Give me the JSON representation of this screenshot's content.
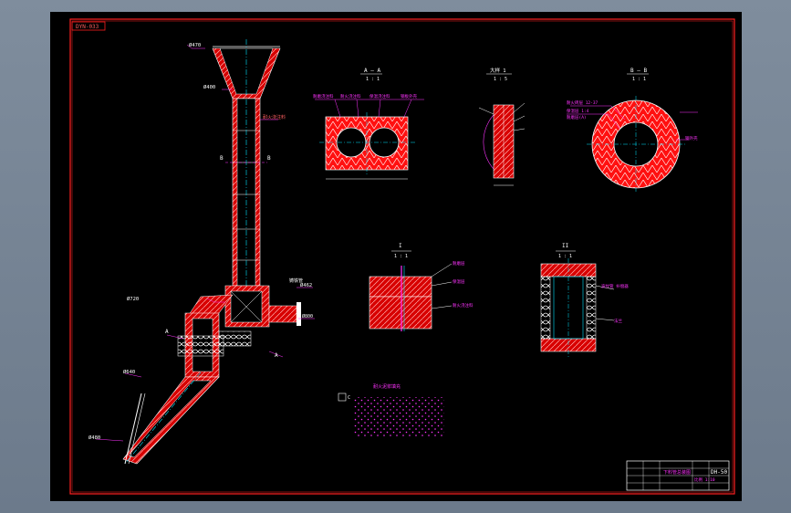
{
  "drawing": {
    "stamp_code": "DYN-033",
    "view_aa": {
      "title": "A — A",
      "scale": "1 : 1"
    },
    "view_bb": {
      "title": "B — B",
      "scale": "1 : 1"
    },
    "view_detail1": {
      "title": "I",
      "scale": "1 : 1"
    },
    "view_detail2": {
      "title": "II",
      "scale": "1 : 1"
    },
    "view_detail_c": {
      "title": "C",
      "scale": "1 : 1"
    },
    "view_center": {
      "title": "大样 1",
      "scale": "1 : 5"
    },
    "main_labels": {
      "top_dim": "Ø470",
      "upper_dim": "Ø400",
      "mid_right": "耐火浇注料",
      "b_left": "B",
      "b_right": "B",
      "elbow_left": "Ø720",
      "elbow_right": "Ø462",
      "elbow_right2": "Ø800",
      "elbow_right3": "铸铁管",
      "lower_left": "Ø640",
      "bottom_left": "Ø480",
      "a_mark": "A",
      "a_mark2": "A"
    },
    "aa_notes": [
      "耐磨浇注料",
      "耐火浇注料",
      "保温浇注料",
      "钢板外壳"
    ],
    "bb_notes": [
      "耐火砖层 12-37",
      "保温层 1:4",
      "耐磨层(A)",
      "钢外壳"
    ],
    "detail_notes": [
      "耐磨层",
      "保温层",
      "耐火浇注料"
    ],
    "detail2_notes": [
      "波纹管 补偿器",
      "法兰"
    ],
    "bottom_note": "耐火泥浆填充",
    "title_block": {
      "drawing_name": "下料管总装图",
      "code": "DH-50",
      "sheet": "比例 1:10"
    }
  }
}
